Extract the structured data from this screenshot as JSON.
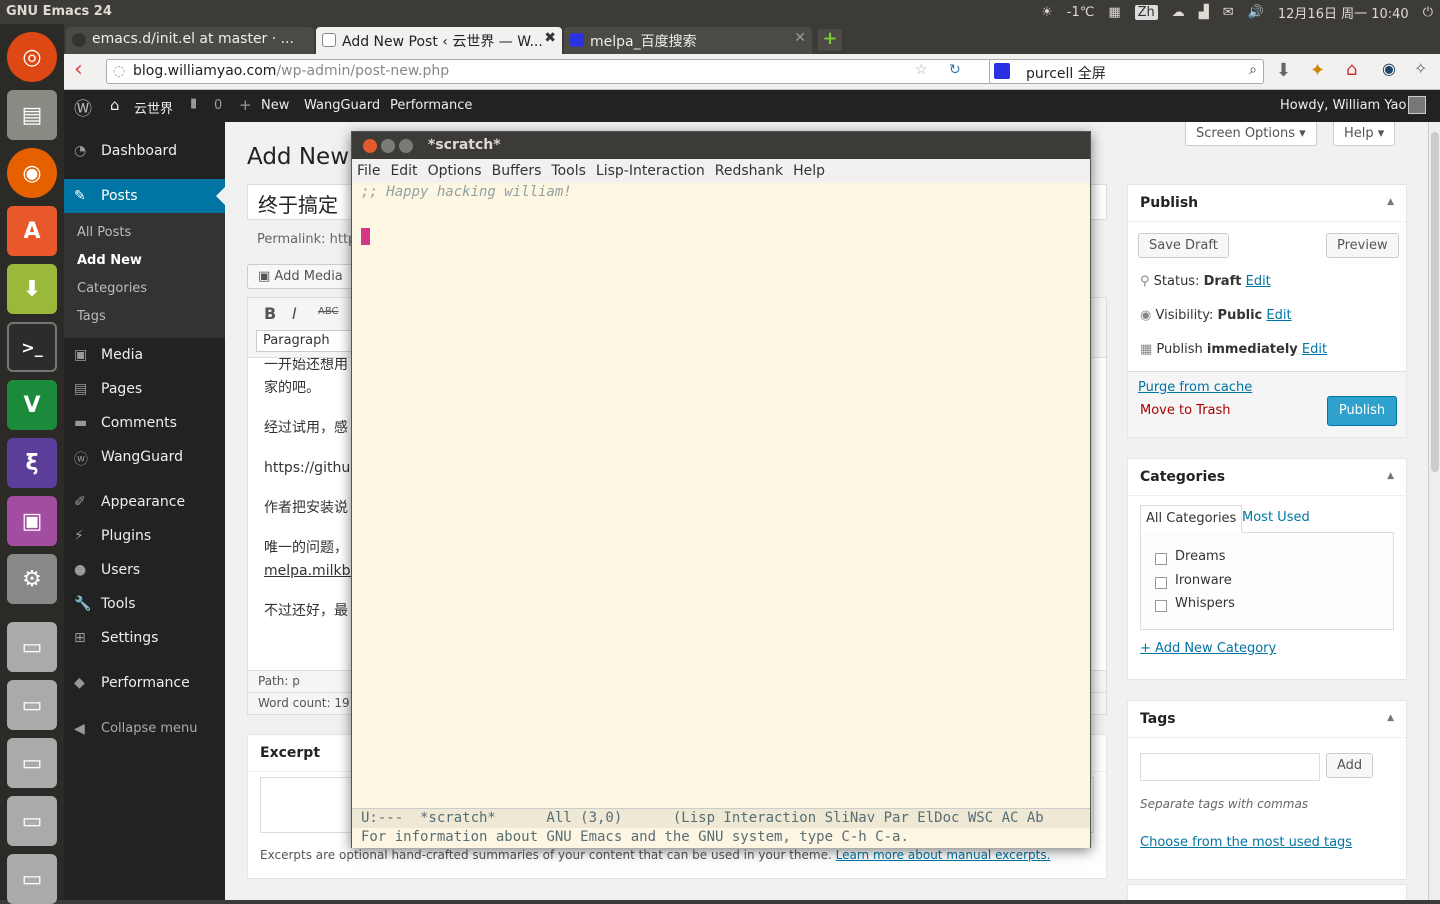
{
  "top": {
    "title": "GNU Emacs 24",
    "temp": "-1℃",
    "lang": "Zh",
    "date": "12月16日 周一  10:40"
  },
  "tabs": [
    {
      "label": "emacs.d/init.el at master · ..."
    },
    {
      "label": "Add New Post ‹ 云世界 — W..."
    },
    {
      "label": "melpa_百度搜索"
    }
  ],
  "nav": {
    "url_host": "blog.williamyao.com",
    "url_path": "/wp-admin/post-new.php",
    "search": "purcell 全屏"
  },
  "adminbar": {
    "site": "云世界",
    "comments": "0",
    "new": "New",
    "wangguard": "WangGuard",
    "performance": "Performance",
    "howdy": "Howdy, William Yao"
  },
  "menu": {
    "dashboard": "Dashboard",
    "posts": "Posts",
    "all_posts": "All Posts",
    "add_new": "Add New",
    "categories": "Categories",
    "tags": "Tags",
    "media": "Media",
    "pages": "Pages",
    "comments": "Comments",
    "wangguard": "WangGuard",
    "appearance": "Appearance",
    "plugins": "Plugins",
    "users": "Users",
    "tools": "Tools",
    "settings": "Settings",
    "performance": "Performance",
    "collapse": "Collapse menu"
  },
  "editor": {
    "heading": "Add New",
    "title_value": "终于搞定",
    "permalink": "Permalink: http",
    "add_media": "Add Media",
    "paragraph": "Paragraph",
    "body": [
      "一开始还想用",
      "家的吧。",
      "经过试用，感",
      "https://githu",
      "作者把安装说",
      "唯一的问题，",
      "melpa.milkbo",
      "不过还好，最"
    ],
    "path": "Path: p",
    "word_count": "Word count: 19"
  },
  "excerpt": {
    "title": "Excerpt",
    "help": "Excerpts are optional hand-crafted summaries of your content that can be used in your theme.",
    "help_link": "Learn more about manual excerpts."
  },
  "screen": {
    "options": "Screen Options ▾",
    "help": "Help ▾"
  },
  "publish": {
    "title": "Publish",
    "save_draft": "Save Draft",
    "preview": "Preview",
    "status_label": "Status:",
    "status": "Draft",
    "visibility_label": "Visibility:",
    "visibility": "Public",
    "publish_label": "Publish",
    "publish_when": "immediately",
    "edit": "Edit",
    "purge": "Purge from cache",
    "trash": "Move to Trash",
    "publish_btn": "Publish"
  },
  "categories": {
    "title": "Categories",
    "tab_all": "All Categories",
    "tab_used": "Most Used",
    "items": [
      "Dreams",
      "Ironware",
      "Whispers"
    ],
    "add": "+ Add New Category"
  },
  "tags": {
    "title": "Tags",
    "add": "Add",
    "hint": "Separate tags with commas",
    "choose": "Choose from the most used tags"
  },
  "emacs": {
    "title": "*scratch*",
    "menu": [
      "File",
      "Edit",
      "Options",
      "Buffers",
      "Tools",
      "Lisp-Interaction",
      "Redshank",
      "Help"
    ],
    "comment": ";; Happy hacking william!",
    "modeline": "U:---  *scratch*      All (3,0)      (Lisp Interaction SliNav Par ElDoc WSC AC Ab",
    "echo": "For information about GNU Emacs and the GNU system, type C-h C-a."
  },
  "colors": {
    "accent": "#0074a2",
    "emacs_bg": "#fdf6e3",
    "cursor": "#d33682"
  }
}
